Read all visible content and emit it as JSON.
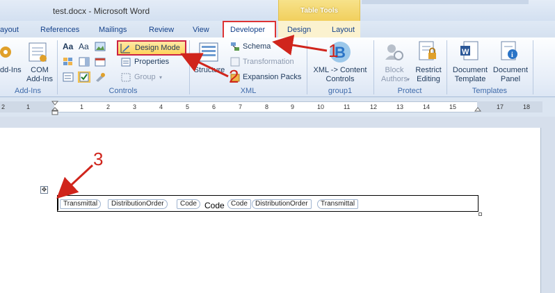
{
  "window": {
    "title": "test.docx - Microsoft Word",
    "contextual_tab_group": "Table Tools"
  },
  "tabs": [
    {
      "label": "ayout"
    },
    {
      "label": "References"
    },
    {
      "label": "Mailings"
    },
    {
      "label": "Review"
    },
    {
      "label": "View"
    },
    {
      "label": "Developer",
      "selected": true
    },
    {
      "label": "Design"
    },
    {
      "label": "Layout"
    }
  ],
  "ribbon": {
    "addins": {
      "group_label": "Add-Ins",
      "addins_label": "dd-Ins",
      "com_addins_label": "COM\nAdd-Ins"
    },
    "controls": {
      "group_label": "Controls",
      "design_mode": "Design Mode",
      "properties": "Properties",
      "group": "Group"
    },
    "xml": {
      "group_label": "XML",
      "structure": "Structure",
      "schema": "Schema",
      "transformation": "Transformation",
      "expansion_packs": "Expansion Packs"
    },
    "group1": {
      "group_label": "group1",
      "xml_content_controls": "XML -> Content\nControls"
    },
    "protect": {
      "group_label": "Protect",
      "block_authors": "Block\nAuthors",
      "restrict_editing": "Restrict\nEditing"
    },
    "templates": {
      "group_label": "Templates",
      "document_template": "Document\nTemplate",
      "document_panel": "Document\nPanel"
    }
  },
  "ruler": {
    "numbers": [
      "2",
      "1",
      "1",
      "2",
      "3",
      "4",
      "5",
      "6",
      "7",
      "8",
      "9",
      "10",
      "11",
      "12",
      "13",
      "14",
      "15",
      "17",
      "18"
    ]
  },
  "document": {
    "tags": [
      "Transmittal",
      "DistributionOrder",
      "Code",
      "Code",
      "DistributionOrder",
      "Transmittal"
    ],
    "code_value": "Code"
  },
  "annotations": [
    "1",
    "2",
    "3"
  ],
  "colors": {
    "annotation_red": "#d0251c",
    "ribbon_bg": "#e7eef8",
    "table_tools": "#f1cf5d"
  }
}
